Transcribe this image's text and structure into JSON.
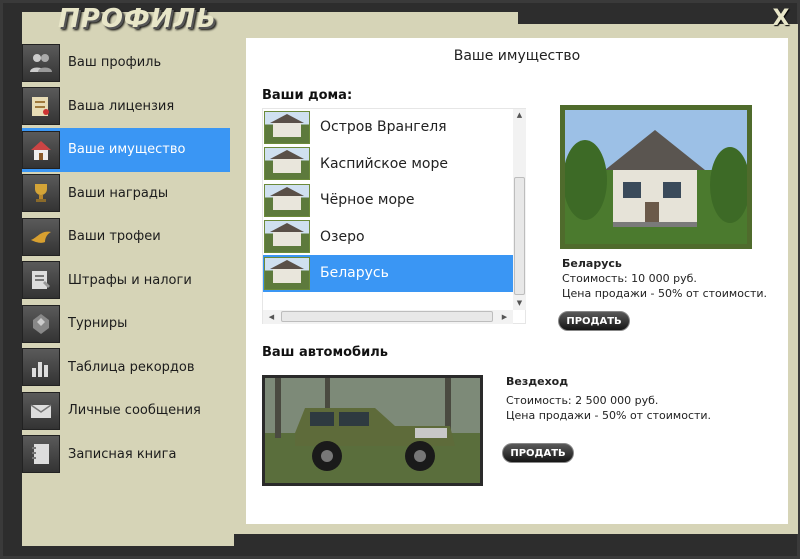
{
  "window": {
    "title": "ПРОФИЛЬ",
    "close_label": "X"
  },
  "sidebar": {
    "items": [
      {
        "label": "Ваш профиль",
        "icon": "users-icon",
        "active": false
      },
      {
        "label": "Ваша лицензия",
        "icon": "license-icon",
        "active": false
      },
      {
        "label": "Ваше имущество",
        "icon": "house-icon",
        "active": true
      },
      {
        "label": "Ваши награды",
        "icon": "trophy-icon",
        "active": false
      },
      {
        "label": "Ваши трофеи",
        "icon": "trophy-bird-icon",
        "active": false
      },
      {
        "label": "Штрафы и налоги",
        "icon": "fines-icon",
        "active": false
      },
      {
        "label": "Турниры",
        "icon": "tournament-icon",
        "active": false
      },
      {
        "label": "Таблица рекордов",
        "icon": "records-chart-icon",
        "active": false
      },
      {
        "label": "Личные сообщения",
        "icon": "envelope-icon",
        "active": false
      },
      {
        "label": "Записная книга",
        "icon": "notebook-icon",
        "active": false
      }
    ]
  },
  "main": {
    "title": "Ваше имущество",
    "houses": {
      "heading": "Ваши дома:",
      "items": [
        {
          "name": "Остров Врангеля",
          "selected": false
        },
        {
          "name": "Каспийское море",
          "selected": false
        },
        {
          "name": "Чёрное море",
          "selected": false
        },
        {
          "name": "Озеро",
          "selected": false
        },
        {
          "name": "Беларусь",
          "selected": true
        }
      ],
      "selected": {
        "name": "Беларусь",
        "cost": "Стоимость: 10 000 руб.",
        "sale": "Цена продажи - 50% от стоимости.",
        "sell_label": "ПРОДАТЬ"
      }
    },
    "car": {
      "heading": "Ваш автомобиль",
      "name": "Вездеход",
      "cost": "Стоимость: 2 500 000 руб.",
      "sale": "Цена продажи - 50% от стоимости.",
      "sell_label": "ПРОДАТЬ"
    }
  },
  "colors": {
    "accent": "#3a96f4",
    "frame": "#2d2d2d",
    "beige": "#d6d4b7",
    "house_border": "#4f6b2c"
  }
}
